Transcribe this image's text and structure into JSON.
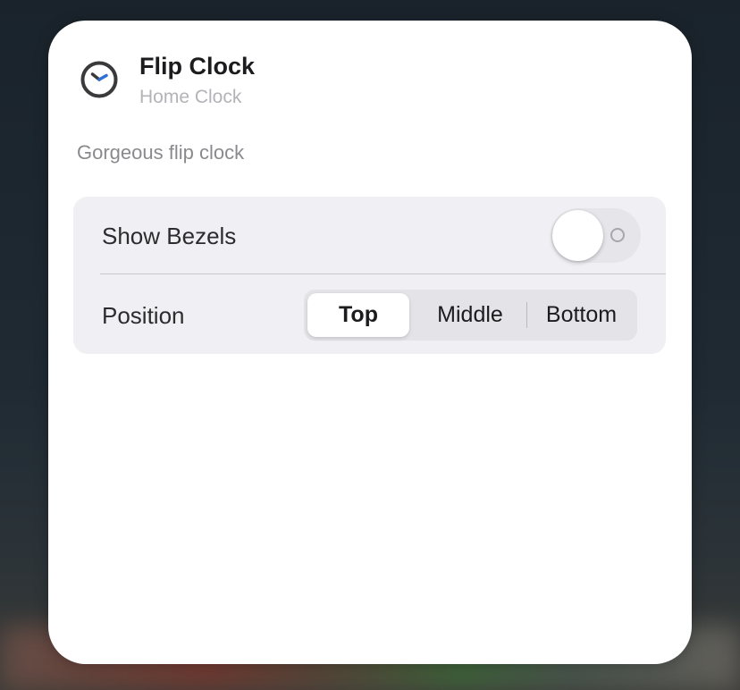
{
  "widget": {
    "title": "Flip Clock",
    "subtitle": "Home Clock",
    "description": "Gorgeous flip clock",
    "icon": "clock-icon"
  },
  "settings": {
    "show_bezels": {
      "label": "Show Bezels",
      "enabled": false
    },
    "position": {
      "label": "Position",
      "options": [
        "Top",
        "Middle",
        "Bottom"
      ],
      "selected": "Top"
    }
  },
  "colors": {
    "clock_hand_accent": "#2f6fd6",
    "clock_outline": "#3a3a3c",
    "card_background": "#ffffff",
    "group_background": "#f0f0f4"
  }
}
